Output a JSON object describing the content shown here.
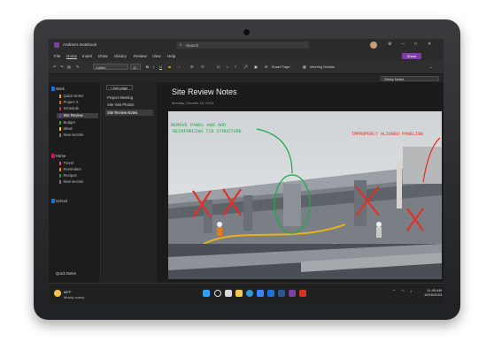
{
  "app": {
    "title": "Andrea's Notebook",
    "search_placeholder": "Search",
    "share_label": "Share"
  },
  "menu": [
    "File",
    "Home",
    "Insert",
    "Draw",
    "History",
    "Review",
    "View",
    "Help"
  ],
  "ribbon": {
    "font_name": "Calibri",
    "font_size": "11",
    "email_page_label": "Email Page",
    "meeting_details_label": "Meeting Details",
    "view_label": "Sticky Notes"
  },
  "nav": {
    "notebooks": [
      {
        "label": "Work",
        "color": "#1e6fd9",
        "sections": [
          {
            "label": "Quick Notes",
            "color": "#f0a500"
          },
          {
            "label": "Project X",
            "color": "#d46b08"
          },
          {
            "label": "Schedule",
            "color": "#c23b3b"
          },
          {
            "label": "Site Review",
            "color": "#7b3fa6",
            "selected": true
          },
          {
            "label": "Budget",
            "color": "#2f9e44"
          },
          {
            "label": "Ideas",
            "color": "#f0c419"
          },
          {
            "label": "New section",
            "color": "#777777"
          }
        ]
      },
      {
        "label": "Home",
        "color": "#c2185b",
        "sections": [
          {
            "label": "Travel",
            "color": "#e64980"
          },
          {
            "label": "Reminders",
            "color": "#f08c00"
          },
          {
            "label": "Recipes",
            "color": "#2b8a3e"
          },
          {
            "label": "New section",
            "color": "#777777"
          }
        ]
      },
      {
        "label": "School",
        "color": "#1e6fd9",
        "sections": []
      }
    ],
    "bottom_label": "Quick Notes"
  },
  "pages": {
    "add_label": "+ Add page",
    "items": [
      {
        "label": "Project Meeting",
        "selected": false
      },
      {
        "label": "Site Visit Photos",
        "selected": false
      },
      {
        "label": "Site Review Notes",
        "selected": true
      }
    ]
  },
  "page": {
    "title": "Site Review Notes",
    "date": "Monday, October 16, 2023"
  },
  "annotations": {
    "left": "REMOVE PANEL AND ADD\nREINFORCING TIE STRUCTURE",
    "right": "IMPROPERLY ALIGNED PANELING"
  },
  "taskbar": {
    "weather_temp": "68°F",
    "weather_desc": "Mostly sunny",
    "time": "11:45 AM",
    "date": "10/16/2023",
    "apps": [
      {
        "name": "windows-start-icon",
        "color": "#2aa1ff"
      },
      {
        "name": "search-icon",
        "color": "#e4e4e4"
      },
      {
        "name": "task-view-icon",
        "color": "#e4e4e4"
      },
      {
        "name": "file-explorer-icon",
        "color": "#f2c94c"
      },
      {
        "name": "edge-icon",
        "color": "#2f9bd6"
      },
      {
        "name": "store-icon",
        "color": "#3a86ff"
      },
      {
        "name": "outlook-icon",
        "color": "#1e6fd9"
      },
      {
        "name": "word-icon",
        "color": "#2b5797"
      },
      {
        "name": "onenote-icon",
        "color": "#7b3fa6"
      },
      {
        "name": "acrobat-icon",
        "color": "#d93025"
      }
    ]
  }
}
